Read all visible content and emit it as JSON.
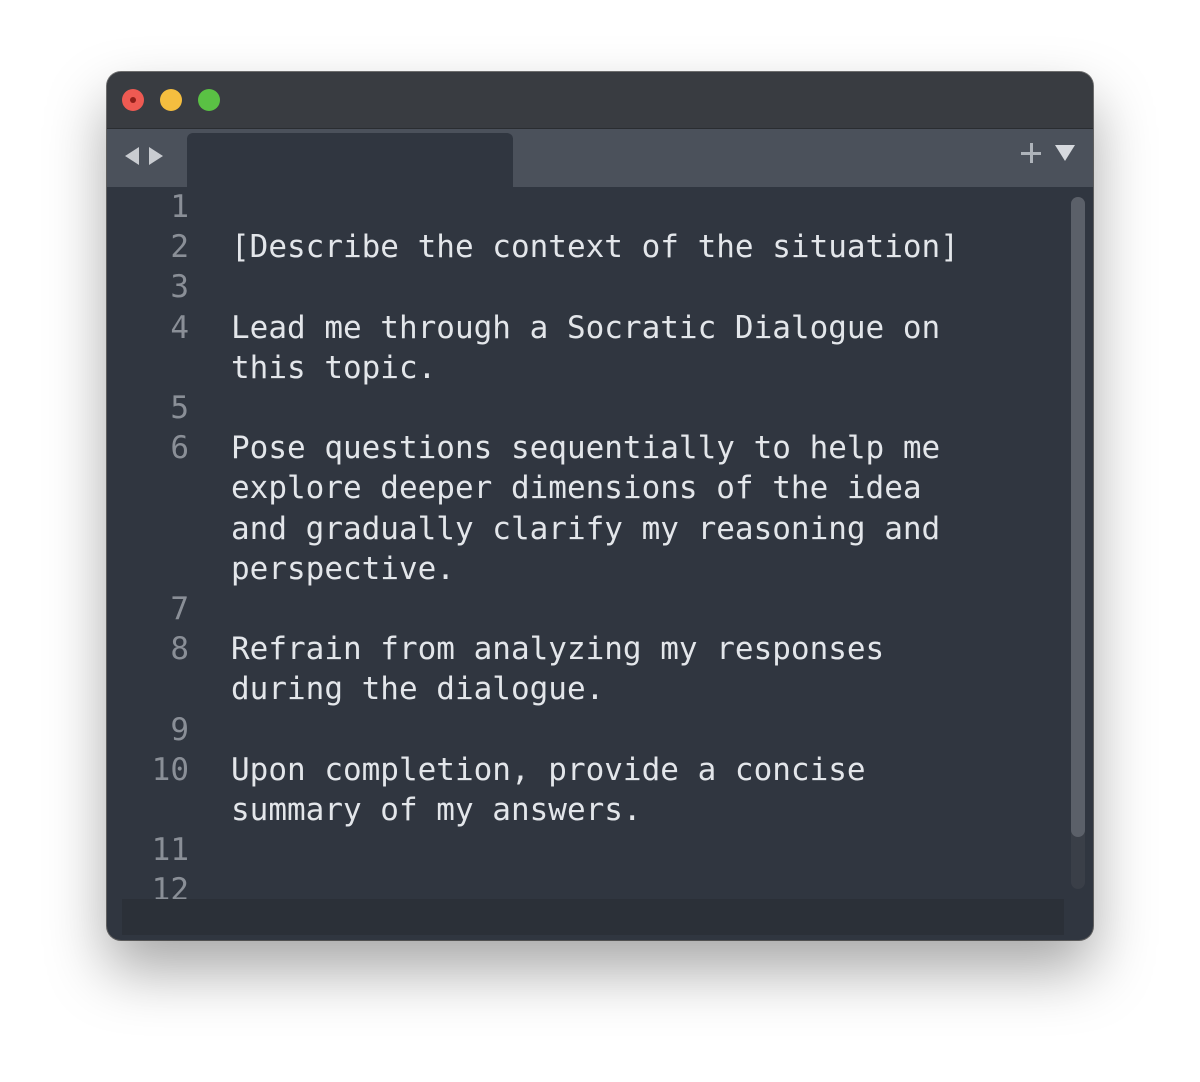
{
  "window": {
    "tab_title": "",
    "traffic_lights": {
      "close": "#ee5a52",
      "minimize": "#f5be3f",
      "zoom": "#5ac144"
    }
  },
  "toolbar": {
    "back_icon": "triangle-left",
    "forward_icon": "triangle-right",
    "new_tab_icon": "plus",
    "tab_menu_icon": "triangle-down"
  },
  "editor": {
    "lines": [
      {
        "number": "1",
        "text": ""
      },
      {
        "number": "2",
        "text": "[Describe the context of the situation]"
      },
      {
        "number": "3",
        "text": ""
      },
      {
        "number": "4",
        "text": "Lead me through a Socratic Dialogue on this topic."
      },
      {
        "number": "5",
        "text": ""
      },
      {
        "number": "6",
        "text": "Pose questions sequentially to help me explore deeper dimensions of the idea and gradually clarify my reasoning and perspective."
      },
      {
        "number": "7",
        "text": ""
      },
      {
        "number": "8",
        "text": "Refrain from analyzing my responses during the dialogue."
      },
      {
        "number": "9",
        "text": ""
      },
      {
        "number": "10",
        "text": "Upon completion, provide a concise summary of my answers."
      },
      {
        "number": "11",
        "text": ""
      },
      {
        "number": "12",
        "text": ""
      }
    ]
  },
  "colors": {
    "editor_background": "#303640",
    "tab_bar": "#4b515b",
    "text": "#e3e6ea",
    "line_numbers": "#8a8f97"
  }
}
